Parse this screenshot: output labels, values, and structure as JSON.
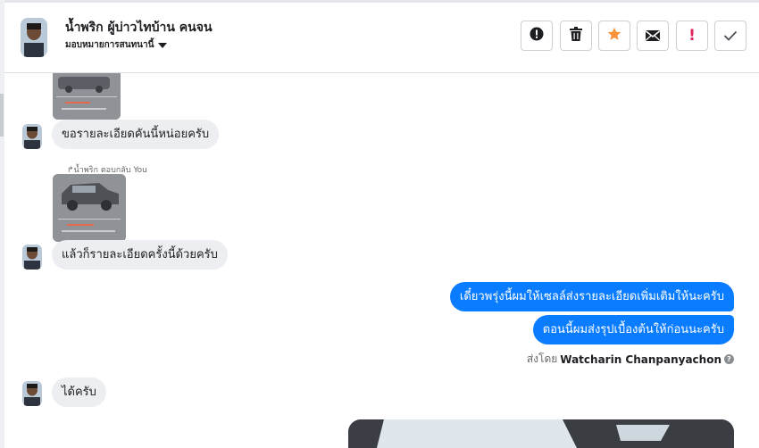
{
  "contact": {
    "name": "น้ำพริก ผู้บ่าวไทบ้าน คนจน",
    "assign_label": "มอบหมายการสนทนานี้"
  },
  "toolbar": [
    {
      "icon": "exclamation-circle-icon",
      "label": "!"
    },
    {
      "icon": "trash-icon"
    },
    {
      "icon": "star-icon",
      "color": "#f7923b"
    },
    {
      "icon": "mail-icon"
    },
    {
      "icon": "important-icon",
      "label": "!",
      "color": "#e0245e"
    },
    {
      "icon": "check-icon"
    }
  ],
  "messages": {
    "m1": "ขอรายละเอียดคันนี้หน่อยครับ",
    "reply_label": "น้ำพริก ตอบกลับ You",
    "m2": "แล้วก็รายละเอียดครั้งนี้ด้วยครับ",
    "m3": "เดี๋ยวพรุ่งนี้ผมให้เซลล์ส่งรายละเอียดเพิ่มเติมให้นะครับ",
    "m4": "ตอนนี้ผมส่งรุปเบื้องต้นให้ก่อนนะครับ",
    "sent_by_prefix": "ส่งโดย",
    "sent_by_name": "Watcharin Chanpanyachon",
    "m5": "ได้ครับ"
  },
  "colors": {
    "outgoing_bubble": "#0a7cff",
    "incoming_bubble": "#eceef1"
  }
}
